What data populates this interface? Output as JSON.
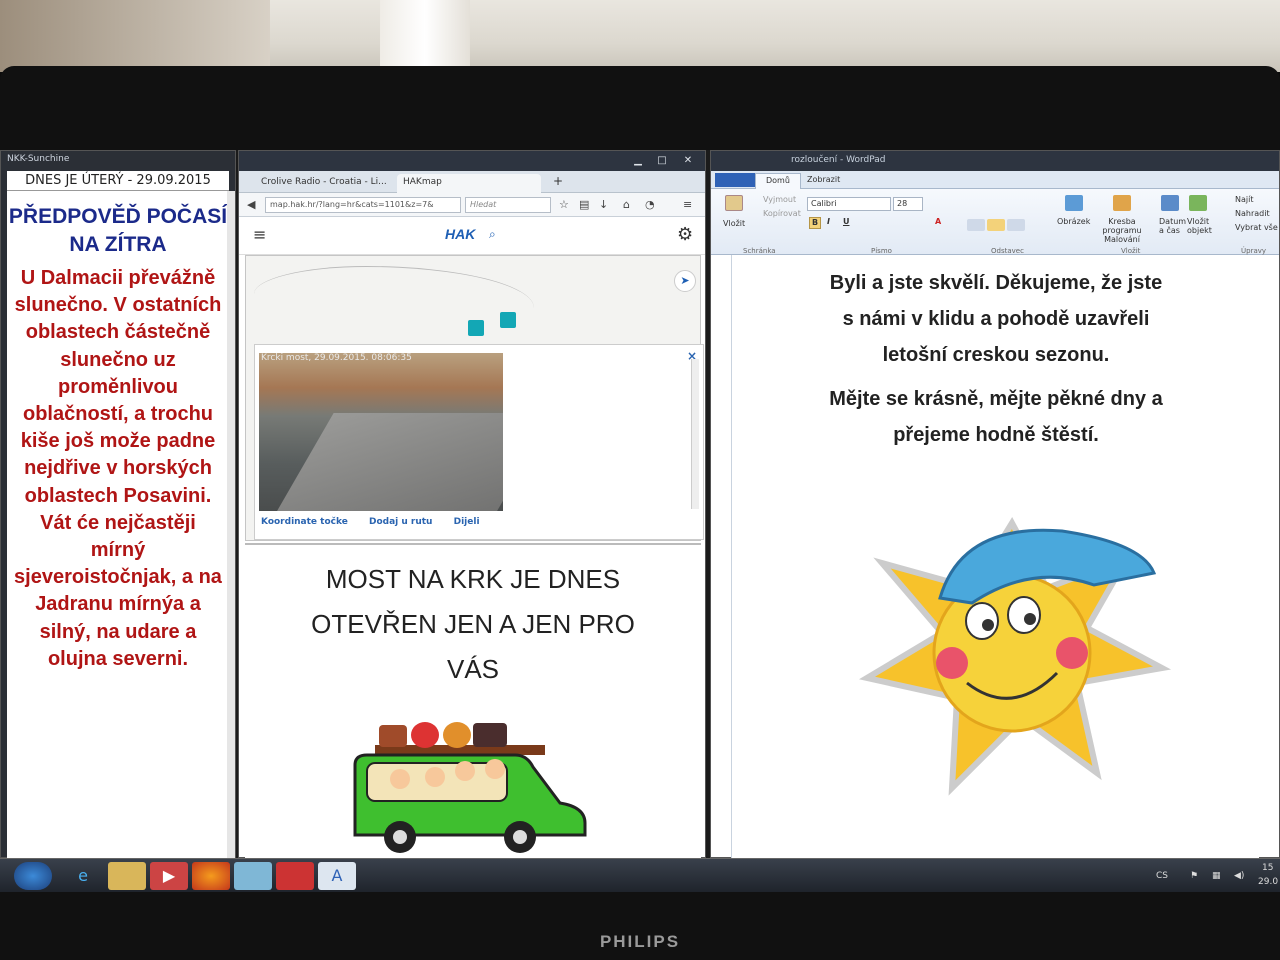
{
  "left_window": {
    "title": "NKK-Sunchine",
    "date_line": "DNES JE ÚTERÝ - 29.09.2015",
    "heading": "PŘEDPOVĚĎ POČASÍ NA ZÍTRA",
    "forecast": "U Dalmacii převážně slunečno. V ostatních oblastech částečně slunečno uz proměnlivou oblačností, a trochu kiše još može padne nejdřive v horských oblastech Posavini. Vát će nejčastěji mírný sjeveroistočnjak, a na Jadranu mírnýa a silný, na udare a olujna severni."
  },
  "browser": {
    "tabs": [
      "Crolive Radio - Croatia - Li...",
      "HAKmap"
    ],
    "new_tab": "+",
    "url": "map.hak.hr/?lang=hr&cats=1101&z=7&",
    "search_placeholder": "Hledat",
    "site_logo": "HAK",
    "camera_stamp": "Krcki most, 29.09.2015. 08:06:35",
    "popup_links": [
      "Koordinate točke",
      "Dodaj u rutu",
      "Dijeli"
    ],
    "close_glyph": "×",
    "headline_lines": [
      "MOST NA KRK JE DNES",
      "OTEVŘEN JEN A JEN PRO",
      "VÁS"
    ]
  },
  "wordpad": {
    "title": "rozloučení - WordPad",
    "ribbon_tabs": [
      "Domů",
      "Zobrazit"
    ],
    "clipboard": {
      "paste": "Vložit",
      "cut": "Vyjmout",
      "copy": "Kopírovat",
      "group": "Schránka"
    },
    "font": {
      "name": "Calibri",
      "size": "28",
      "group": "Písmo"
    },
    "paragraph_group": "Odstavec",
    "insert": {
      "picture": "Obrázek",
      "paint": "Kresba programu Malování",
      "datetime": "Datum a čas",
      "object": "Vložit objekt",
      "group": "Vložit"
    },
    "edit": {
      "find": "Najít",
      "replace": "Nahradit",
      "select_all": "Vybrat vše",
      "group": "Úpravy"
    },
    "paragraphs": [
      "Byli a jste skvělí. Děkujeme, že jste s námi v klidu a pohodě uzavřeli letošní creskou sezonu.",
      "Mějte se krásně, mějte pěkné dny a přejeme hodně štěstí."
    ]
  },
  "taskbar": {
    "lang": "CS",
    "time": "15",
    "date": "29.0"
  },
  "monitor_brand": "PHILIPS"
}
